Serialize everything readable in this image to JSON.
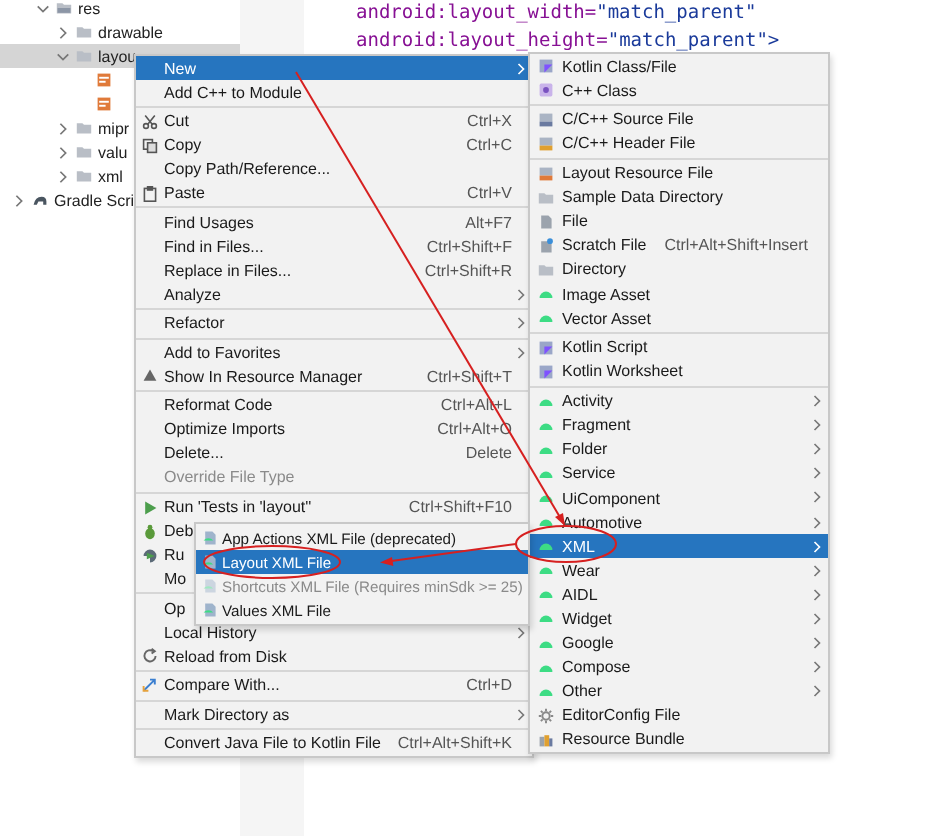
{
  "project_tree": [
    {
      "label": "res",
      "kind": "res",
      "expanded": true,
      "selected": false,
      "children": [
        {
          "label": "drawable",
          "kind": "folder",
          "expanded": false,
          "selected": false
        },
        {
          "label": "layou",
          "kind": "folder",
          "expanded": true,
          "selected": true,
          "children": [
            {
              "kind": "file",
              "selected": false
            },
            {
              "kind": "file",
              "selected": false
            }
          ]
        },
        {
          "label": "mipr",
          "kind": "folder",
          "expanded": false,
          "selected": false
        },
        {
          "label": "valu",
          "kind": "folder",
          "expanded": false,
          "selected": false
        },
        {
          "label": "xml",
          "kind": "folder",
          "expanded": false,
          "selected": false
        }
      ]
    },
    {
      "label": "Gradle Scri",
      "kind": "gradle",
      "expanded": false,
      "selected": false
    }
  ],
  "editor": {
    "lines": [
      {
        "attribute": "android:layout_width=",
        "value": "\"match_parent\""
      },
      {
        "attribute": "android:layout_height=",
        "value": "\"match_parent\">"
      }
    ]
  },
  "context_menu": {
    "items": [
      {
        "kind": "plain",
        "label": "New",
        "submenu": true,
        "selected": true,
        "disabled": false
      },
      {
        "kind": "plain",
        "label": "Add C++ to Module",
        "submenu": false,
        "selected": false,
        "disabled": false
      },
      {
        "kind": "separator"
      },
      {
        "kind": "scissors",
        "label": "Cut",
        "shortcut": "Ctrl+X",
        "submenu": false,
        "selected": false,
        "disabled": false
      },
      {
        "kind": "copy",
        "label": "Copy",
        "shortcut": "Ctrl+C",
        "submenu": false,
        "selected": false,
        "disabled": false
      },
      {
        "kind": "plain",
        "label": "Copy Path/Reference...",
        "submenu": false,
        "selected": false,
        "disabled": false
      },
      {
        "kind": "clipboard",
        "label": "Paste",
        "shortcut": "Ctrl+V",
        "submenu": false,
        "selected": false,
        "disabled": false
      },
      {
        "kind": "separator"
      },
      {
        "kind": "plain",
        "label": "Find Usages",
        "shortcut": "Alt+F7",
        "submenu": false,
        "selected": false,
        "disabled": false
      },
      {
        "kind": "plain",
        "label": "Find in Files...",
        "shortcut": "Ctrl+Shift+F",
        "submenu": false,
        "selected": false,
        "disabled": false
      },
      {
        "kind": "plain",
        "label": "Replace in Files...",
        "shortcut": "Ctrl+Shift+R",
        "submenu": false,
        "selected": false,
        "disabled": false
      },
      {
        "kind": "plain",
        "label": "Analyze",
        "submenu": true,
        "selected": false,
        "disabled": false
      },
      {
        "kind": "separator"
      },
      {
        "kind": "plain",
        "label": "Refactor",
        "submenu": true,
        "selected": false,
        "disabled": false
      },
      {
        "kind": "separator"
      },
      {
        "kind": "plain",
        "label": "Add to Favorites",
        "submenu": true,
        "selected": false,
        "disabled": false
      },
      {
        "kind": "triangle",
        "label": "Show In Resource Manager",
        "shortcut": "Ctrl+Shift+T",
        "submenu": false,
        "selected": false,
        "disabled": false
      },
      {
        "kind": "separator"
      },
      {
        "kind": "plain",
        "label": "Reformat Code",
        "shortcut": "Ctrl+Alt+L",
        "submenu": false,
        "selected": false,
        "disabled": false
      },
      {
        "kind": "plain",
        "label": "Optimize Imports",
        "shortcut": "Ctrl+Alt+O",
        "submenu": false,
        "selected": false,
        "disabled": false
      },
      {
        "kind": "plain",
        "label": "Delete...",
        "shortcut": "Delete",
        "submenu": false,
        "selected": false,
        "disabled": false
      },
      {
        "kind": "plain",
        "label": "Override File Type",
        "submenu": false,
        "selected": false,
        "disabled": true
      },
      {
        "kind": "separator"
      },
      {
        "kind": "play",
        "label": "Run 'Tests in 'layout''",
        "shortcut": "Ctrl+Shift+F10",
        "submenu": false,
        "selected": false,
        "disabled": false
      },
      {
        "kind": "bug",
        "label": "Deb",
        "selected": false,
        "disabled": false
      },
      {
        "kind": "coverage",
        "label": "Ru",
        "selected": false,
        "disabled": false
      },
      {
        "kind": "plain",
        "label": "Mo",
        "selected": false,
        "disabled": false
      },
      {
        "kind": "separator"
      },
      {
        "kind": "plain",
        "label": "Op",
        "selected": false,
        "disabled": false
      },
      {
        "kind": "plain",
        "label": "Local History",
        "submenu": true,
        "selected": false,
        "disabled": false
      },
      {
        "kind": "reload",
        "label": "Reload from Disk",
        "submenu": false,
        "selected": false,
        "disabled": false
      },
      {
        "kind": "separator"
      },
      {
        "kind": "compare",
        "label": "Compare With...",
        "shortcut": "Ctrl+D",
        "submenu": false,
        "selected": false,
        "disabled": false
      },
      {
        "kind": "separator"
      },
      {
        "kind": "plain",
        "label": "Mark Directory as",
        "submenu": true,
        "selected": false,
        "disabled": false
      },
      {
        "kind": "separator"
      },
      {
        "kind": "plain",
        "label": "Convert Java File to Kotlin File",
        "shortcut": "Ctrl+Alt+Shift+K",
        "submenu": false,
        "selected": false,
        "disabled": false
      }
    ]
  },
  "new_submenu": {
    "items": [
      {
        "kind": "kotlin",
        "label": "Kotlin Class/File",
        "submenu": false,
        "selected": false
      },
      {
        "kind": "cpp",
        "label": "C++ Class",
        "submenu": false,
        "selected": false
      },
      {
        "kind": "separator"
      },
      {
        "kind": "source",
        "label": "C/C++ Source File",
        "submenu": false,
        "selected": false
      },
      {
        "kind": "header",
        "label": "C/C++ Header File",
        "submenu": false,
        "selected": false
      },
      {
        "kind": "separator"
      },
      {
        "kind": "layout",
        "label": "Layout Resource File",
        "submenu": false,
        "selected": false
      },
      {
        "kind": "folder",
        "label": "Sample Data Directory",
        "submenu": false,
        "selected": false
      },
      {
        "kind": "file",
        "label": "File",
        "submenu": false,
        "selected": false
      },
      {
        "kind": "scratch",
        "label": "Scratch File",
        "shortcut": "Ctrl+Alt+Shift+Insert",
        "submenu": false,
        "selected": false
      },
      {
        "kind": "folder",
        "label": "Directory",
        "submenu": false,
        "selected": false
      },
      {
        "kind": "android",
        "label": "Image Asset",
        "submenu": false,
        "selected": false
      },
      {
        "kind": "android",
        "label": "Vector Asset",
        "submenu": false,
        "selected": false
      },
      {
        "kind": "separator"
      },
      {
        "kind": "kotlin",
        "label": "Kotlin Script",
        "submenu": false,
        "selected": false
      },
      {
        "kind": "kotlin",
        "label": "Kotlin Worksheet",
        "submenu": false,
        "selected": false
      },
      {
        "kind": "separator"
      },
      {
        "kind": "android",
        "label": "Activity",
        "submenu": true,
        "selected": false
      },
      {
        "kind": "android",
        "label": "Fragment",
        "submenu": true,
        "selected": false
      },
      {
        "kind": "android",
        "label": "Folder",
        "submenu": true,
        "selected": false
      },
      {
        "kind": "android",
        "label": "Service",
        "submenu": true,
        "selected": false
      },
      {
        "kind": "android",
        "label": "UiComponent",
        "submenu": true,
        "selected": false
      },
      {
        "kind": "android",
        "label": "Automotive",
        "submenu": true,
        "selected": false
      },
      {
        "kind": "android",
        "label": "XML",
        "submenu": true,
        "selected": true
      },
      {
        "kind": "android",
        "label": "Wear",
        "submenu": true,
        "selected": false
      },
      {
        "kind": "android",
        "label": "AIDL",
        "submenu": true,
        "selected": false
      },
      {
        "kind": "android",
        "label": "Widget",
        "submenu": true,
        "selected": false
      },
      {
        "kind": "android",
        "label": "Google",
        "submenu": true,
        "selected": false
      },
      {
        "kind": "android",
        "label": "Compose",
        "submenu": true,
        "selected": false
      },
      {
        "kind": "android",
        "label": "Other",
        "submenu": true,
        "selected": false
      },
      {
        "kind": "gear",
        "label": "EditorConfig File",
        "submenu": false,
        "selected": false
      },
      {
        "kind": "bundle",
        "label": "Resource Bundle",
        "submenu": false,
        "selected": false
      }
    ]
  },
  "xml_submenu": {
    "items": [
      {
        "kind": "xml",
        "label": "App Actions XML File (deprecated)",
        "selected": false,
        "disabled": false
      },
      {
        "kind": "xml",
        "label": "Layout XML File",
        "selected": true,
        "disabled": false
      },
      {
        "kind": "xml",
        "label": "Shortcuts XML File (Requires minSdk >= 25)",
        "selected": false,
        "disabled": true
      },
      {
        "kind": "xml",
        "label": "Values XML File",
        "selected": false,
        "disabled": false
      }
    ]
  }
}
